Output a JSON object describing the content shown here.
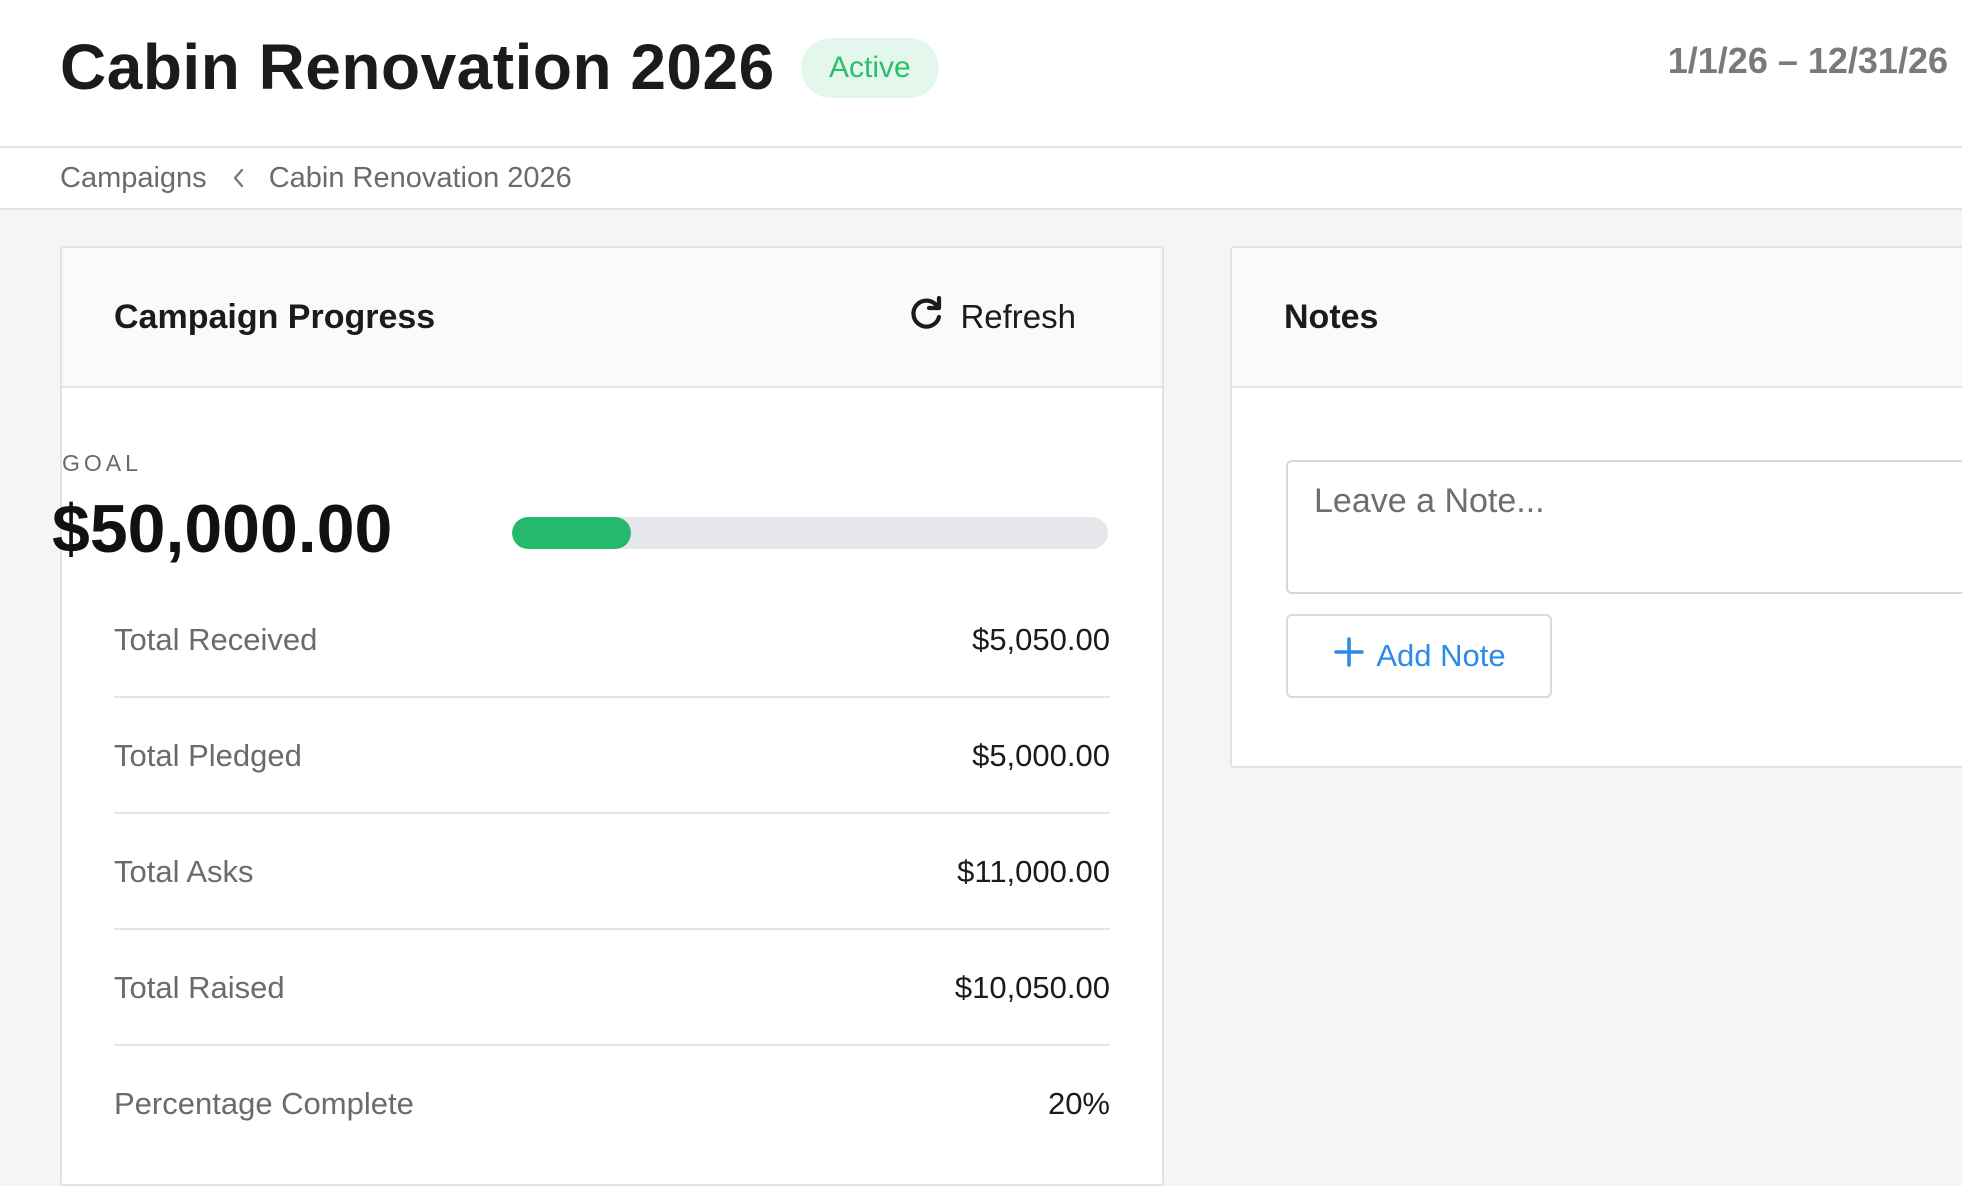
{
  "header": {
    "title": "Cabin Renovation 2026",
    "status": "Active",
    "date_range": "1/1/26 – 12/31/26"
  },
  "breadcrumb": {
    "items": [
      "Campaigns",
      "Cabin Renovation 2026"
    ]
  },
  "progress_card": {
    "title": "Campaign Progress",
    "refresh_label": "Refresh",
    "goal_label": "GOAL",
    "goal_amount": "$50,000.00",
    "progress_fraction": 0.2,
    "stats": [
      {
        "label": "Total Received",
        "value": "$5,050.00"
      },
      {
        "label": "Total Pledged",
        "value": "$5,000.00"
      },
      {
        "label": "Total Asks",
        "value": "$11,000.00"
      },
      {
        "label": "Total Raised",
        "value": "$10,050.00"
      },
      {
        "label": "Percentage Complete",
        "value": "20%"
      }
    ]
  },
  "notes_card": {
    "title": "Notes",
    "placeholder": "Leave a Note...",
    "add_label": "Add Note"
  },
  "colors": {
    "status_green": "#2bbf6c",
    "progress_green": "#25b96d",
    "accent_blue": "#2b8be6"
  },
  "icons": {
    "breadcrumb_separator": "chevron-left-icon",
    "refresh": "refresh-icon",
    "add_note": "plus-icon"
  }
}
